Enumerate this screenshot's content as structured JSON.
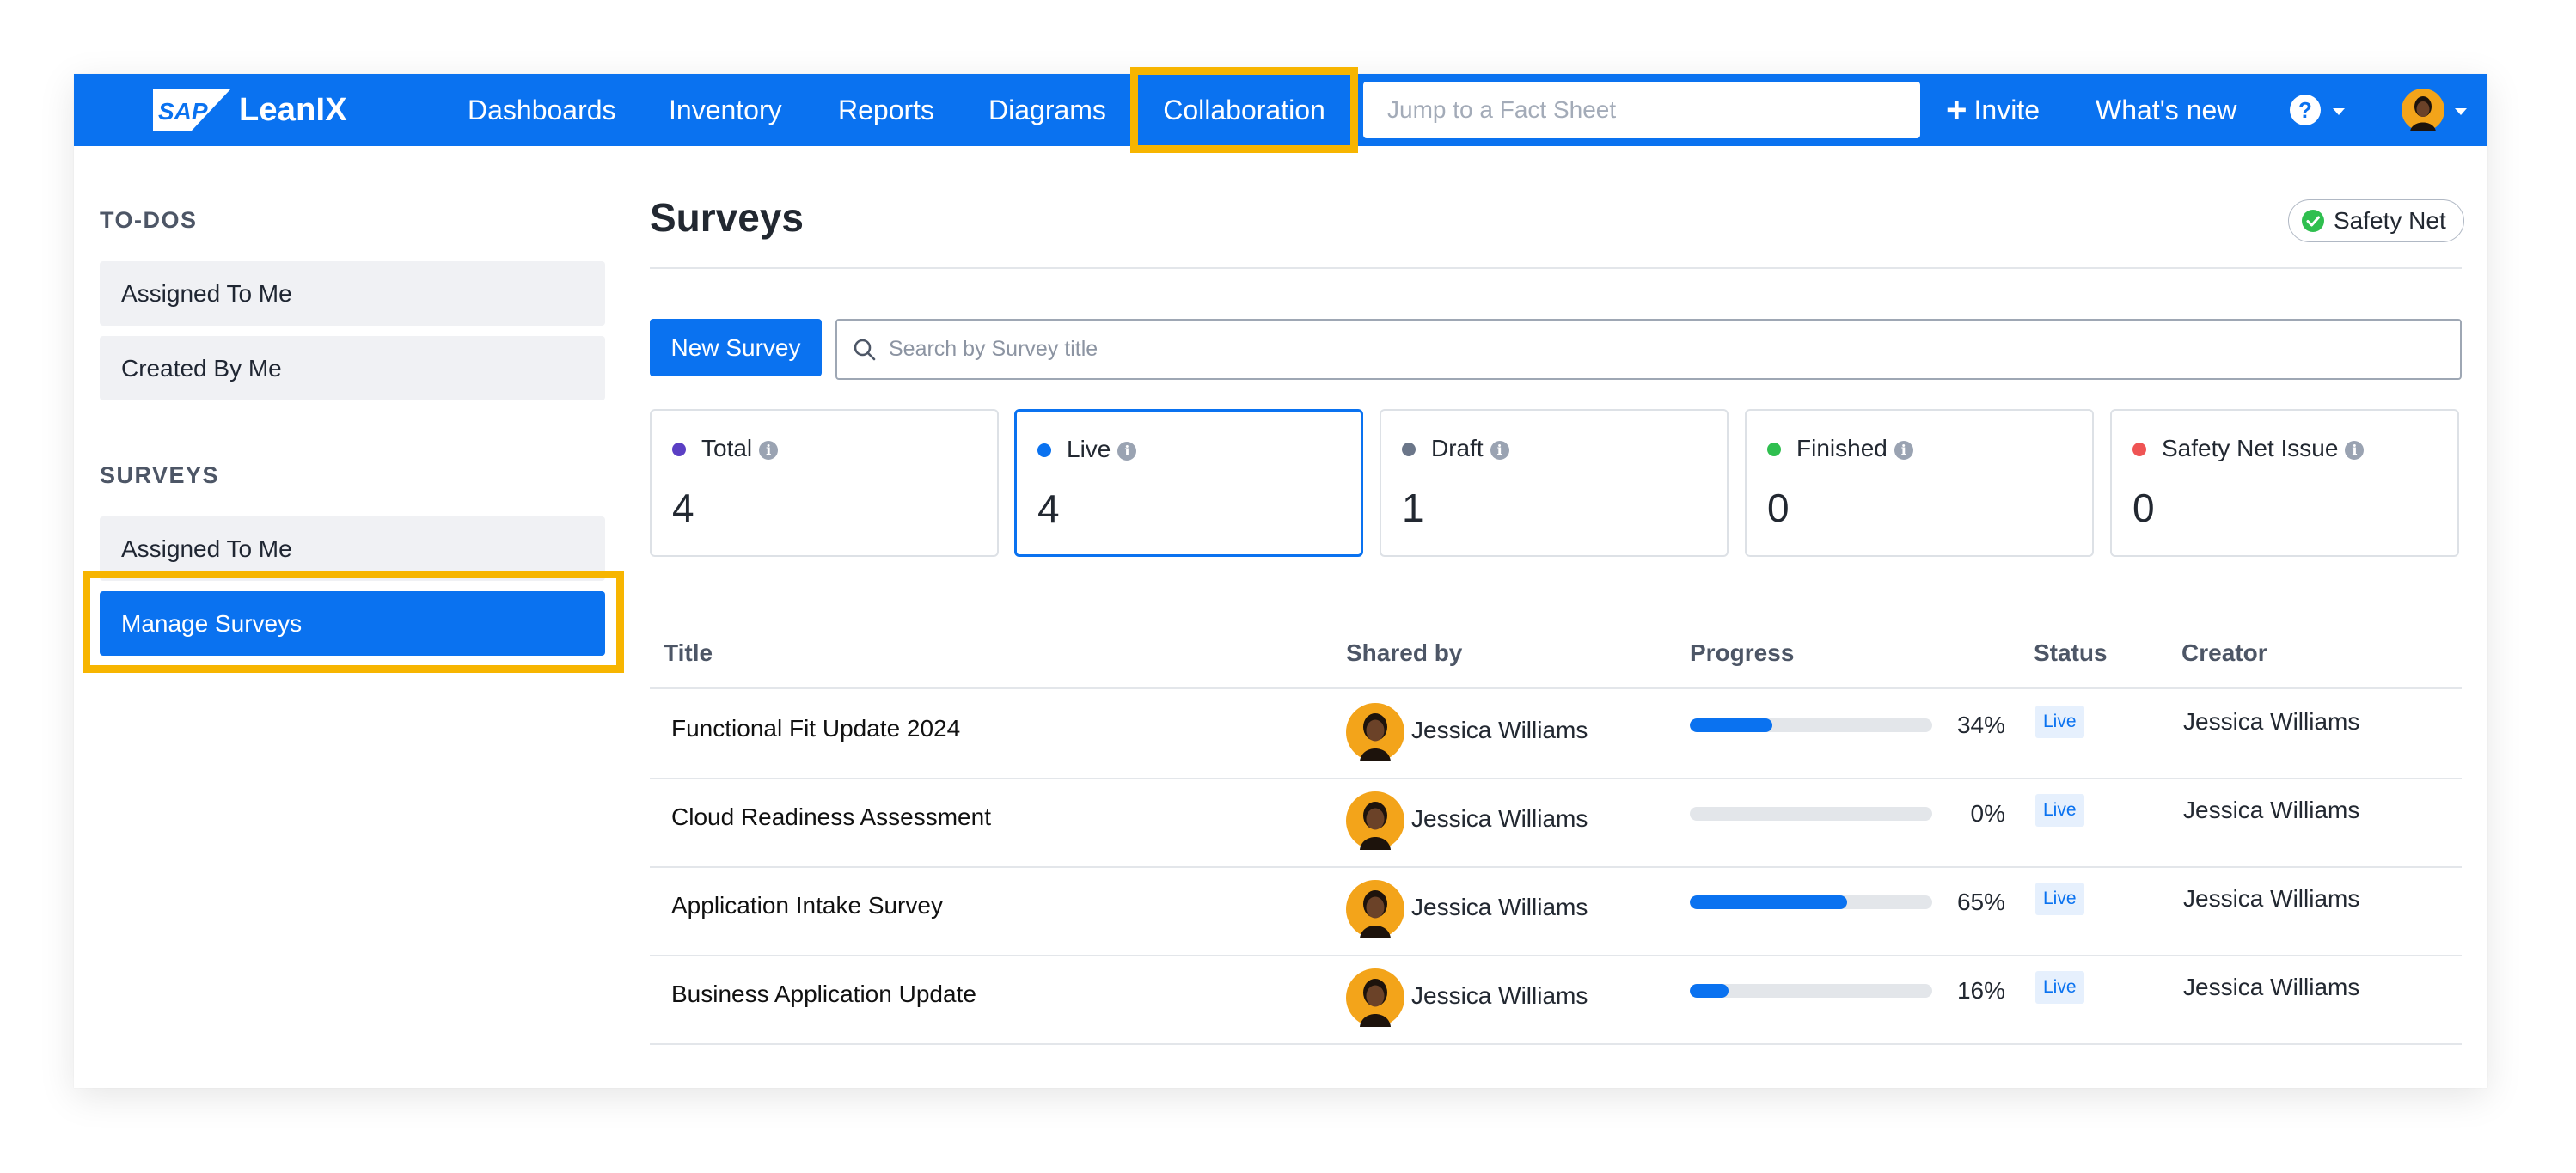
{
  "nav": {
    "brand_logo": "SAP",
    "brand_name": "LeanIX",
    "links": [
      "Dashboards",
      "Inventory",
      "Reports",
      "Diagrams"
    ],
    "active_link": "Collaboration",
    "jump_placeholder": "Jump to a Fact Sheet",
    "invite_label": "Invite",
    "whats_new_label": "What's new",
    "help_glyph": "?",
    "accent_color": "#0a72f0",
    "highlight_color": "#f7b500"
  },
  "sidebar": {
    "todos_title": "TO-DOS",
    "todos_items": [
      "Assigned To Me",
      "Created By Me"
    ],
    "surveys_title": "SURVEYS",
    "surveys_items": [
      "Assigned To Me",
      "Manage Surveys"
    ],
    "active_item": "Manage Surveys"
  },
  "main": {
    "title": "Surveys",
    "safety_badge": "Safety Net",
    "new_survey_label": "New Survey",
    "search_placeholder": "Search by Survey title",
    "stats": [
      {
        "label": "Total",
        "value": "4",
        "color": "#5b3fc4"
      },
      {
        "label": "Live",
        "value": "4",
        "color": "#0a72f0",
        "selected": true
      },
      {
        "label": "Draft",
        "value": "1",
        "color": "#6b7689"
      },
      {
        "label": "Finished",
        "value": "0",
        "color": "#2fbf4f"
      },
      {
        "label": "Safety Net Issue",
        "value": "0",
        "color": "#ef5454"
      }
    ],
    "table": {
      "columns": [
        "Title",
        "Shared by",
        "Progress",
        "Status",
        "Creator"
      ],
      "rows": [
        {
          "title": "Functional Fit Update 2024",
          "shared_by": "Jessica Williams",
          "progress": 34,
          "progress_label": "34%",
          "status": "Live",
          "creator": "Jessica Williams"
        },
        {
          "title": "Cloud Readiness Assessment",
          "shared_by": "Jessica Williams",
          "progress": 0,
          "progress_label": "0%",
          "status": "Live",
          "creator": "Jessica Williams"
        },
        {
          "title": "Application Intake Survey",
          "shared_by": "Jessica Williams",
          "progress": 65,
          "progress_label": "65%",
          "status": "Live",
          "creator": "Jessica Williams"
        },
        {
          "title": "Business Application Update",
          "shared_by": "Jessica Williams",
          "progress": 16,
          "progress_label": "16%",
          "status": "Live",
          "creator": "Jessica Williams"
        }
      ]
    }
  }
}
